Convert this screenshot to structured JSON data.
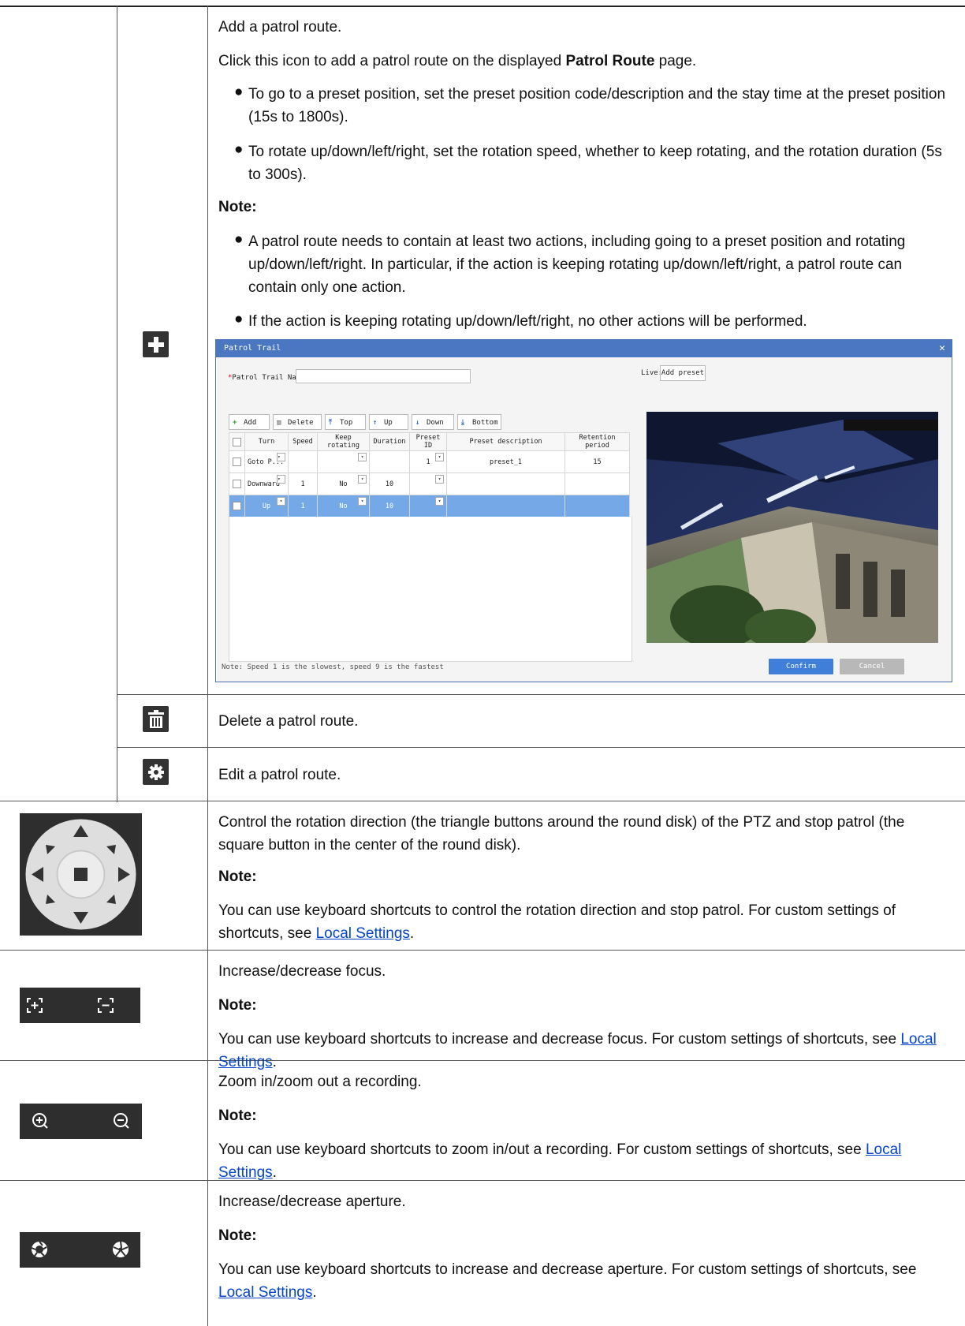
{
  "add_row": {
    "intro": "Add a patrol route.",
    "click_prefix": "Click this icon to add a patrol route on the displayed ",
    "click_bold": "Patrol Route",
    "click_suffix": " page.",
    "bullets": [
      "To go to a preset position, set the preset position code/description and the stay time at the preset position (15s to 1800s).",
      "To rotate up/down/left/right, set the rotation speed, whether to keep rotating, and the rotation duration (5s to 300s)."
    ],
    "note_label": "Note:",
    "note_bullets": [
      "A patrol route needs to contain at least two actions, including going to a preset position and rotating up/down/left/right. In particular, if the action is keeping rotating up/down/left/right, a patrol route can contain only one action.",
      "If the action is keeping rotating up/down/left/right, no other actions will be performed."
    ]
  },
  "dialog": {
    "title": "Patrol Trail",
    "name_label": "Patrol Trail Name:",
    "live_label": "Live:",
    "add_preset": "Add preset",
    "toolbar": [
      "Add",
      "Delete",
      "Top",
      "Up",
      "Down",
      "Bottom"
    ],
    "columns": [
      "Turn",
      "Speed",
      "Keep rotating",
      "Duration",
      "Preset ID",
      "Preset description",
      "Retention period"
    ],
    "rows": [
      {
        "turn": "Goto P...",
        "speed": "",
        "keep": "",
        "duration": "",
        "preset_id": "1",
        "desc": "preset_1",
        "retention": "15"
      },
      {
        "turn": "Downward",
        "speed": "1",
        "keep": "No",
        "duration": "10",
        "preset_id": "",
        "desc": "",
        "retention": ""
      },
      {
        "turn": "Up",
        "speed": "1",
        "keep": "No",
        "duration": "10",
        "preset_id": "",
        "desc": "",
        "retention": ""
      }
    ],
    "footer_note": "Note: Speed 1 is the slowest, speed 9 is the fastest",
    "confirm": "Confirm",
    "cancel": "Cancel"
  },
  "delete_row": {
    "text": "Delete a patrol route."
  },
  "edit_row": {
    "text": "Edit a patrol route."
  },
  "ptz_row": {
    "text": "Control the rotation direction (the triangle buttons around the round disk) of the PTZ and stop patrol (the square button in the center of the round disk).",
    "note_label": "Note:",
    "note_prefix": "You can use keyboard shortcuts to control the rotation direction and stop patrol. For custom settings of shortcuts, see ",
    "link": "Local Settings",
    "note_suffix": "."
  },
  "focus_row": {
    "text": "Increase/decrease focus.",
    "note_label": "Note:",
    "note_prefix": "You can use keyboard shortcuts to increase and decrease focus. For custom settings of shortcuts, see ",
    "link": "Local Settings",
    "note_suffix": "."
  },
  "zoom_row": {
    "text": "Zoom in/zoom out a recording.",
    "note_label": "Note:",
    "note_prefix": "You can use keyboard shortcuts to zoom in/out a recording. For custom settings of shortcuts, see ",
    "link": "Local Settings",
    "note_suffix": "."
  },
  "aperture_row": {
    "text": "Increase/decrease aperture.",
    "note_label": "Note:",
    "note_prefix": "You can use keyboard shortcuts to increase and decrease aperture. For custom settings of shortcuts, see ",
    "link": "Local Settings",
    "note_suffix": "."
  }
}
